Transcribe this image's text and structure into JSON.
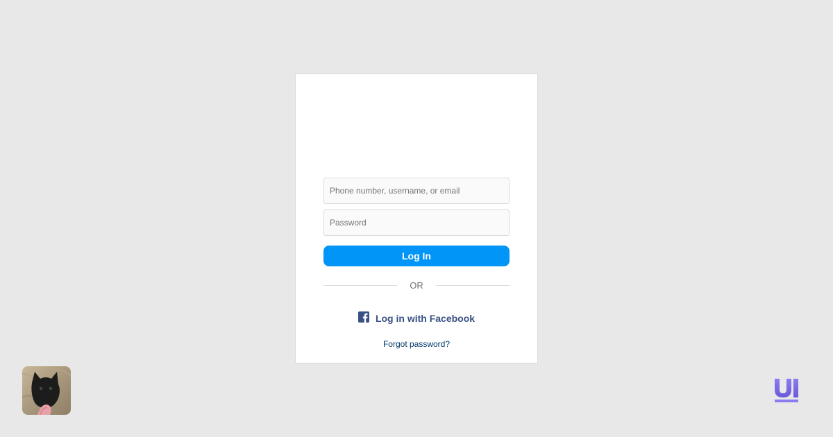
{
  "login": {
    "username_placeholder": "Phone number, username, or email",
    "password_placeholder": "Password",
    "login_button": "Log In",
    "divider_text": "OR",
    "facebook_login": "Log in with Facebook",
    "forgot_password": "Forgot password?"
  },
  "branding": {
    "corner_logo": "UI"
  },
  "icons": {
    "facebook": "facebook-square-icon",
    "avatar": "cat-photo-avatar"
  },
  "colors": {
    "primary": "#0095f6",
    "facebook_text": "#385185",
    "link": "#00376b",
    "background": "#e8e8e8"
  }
}
